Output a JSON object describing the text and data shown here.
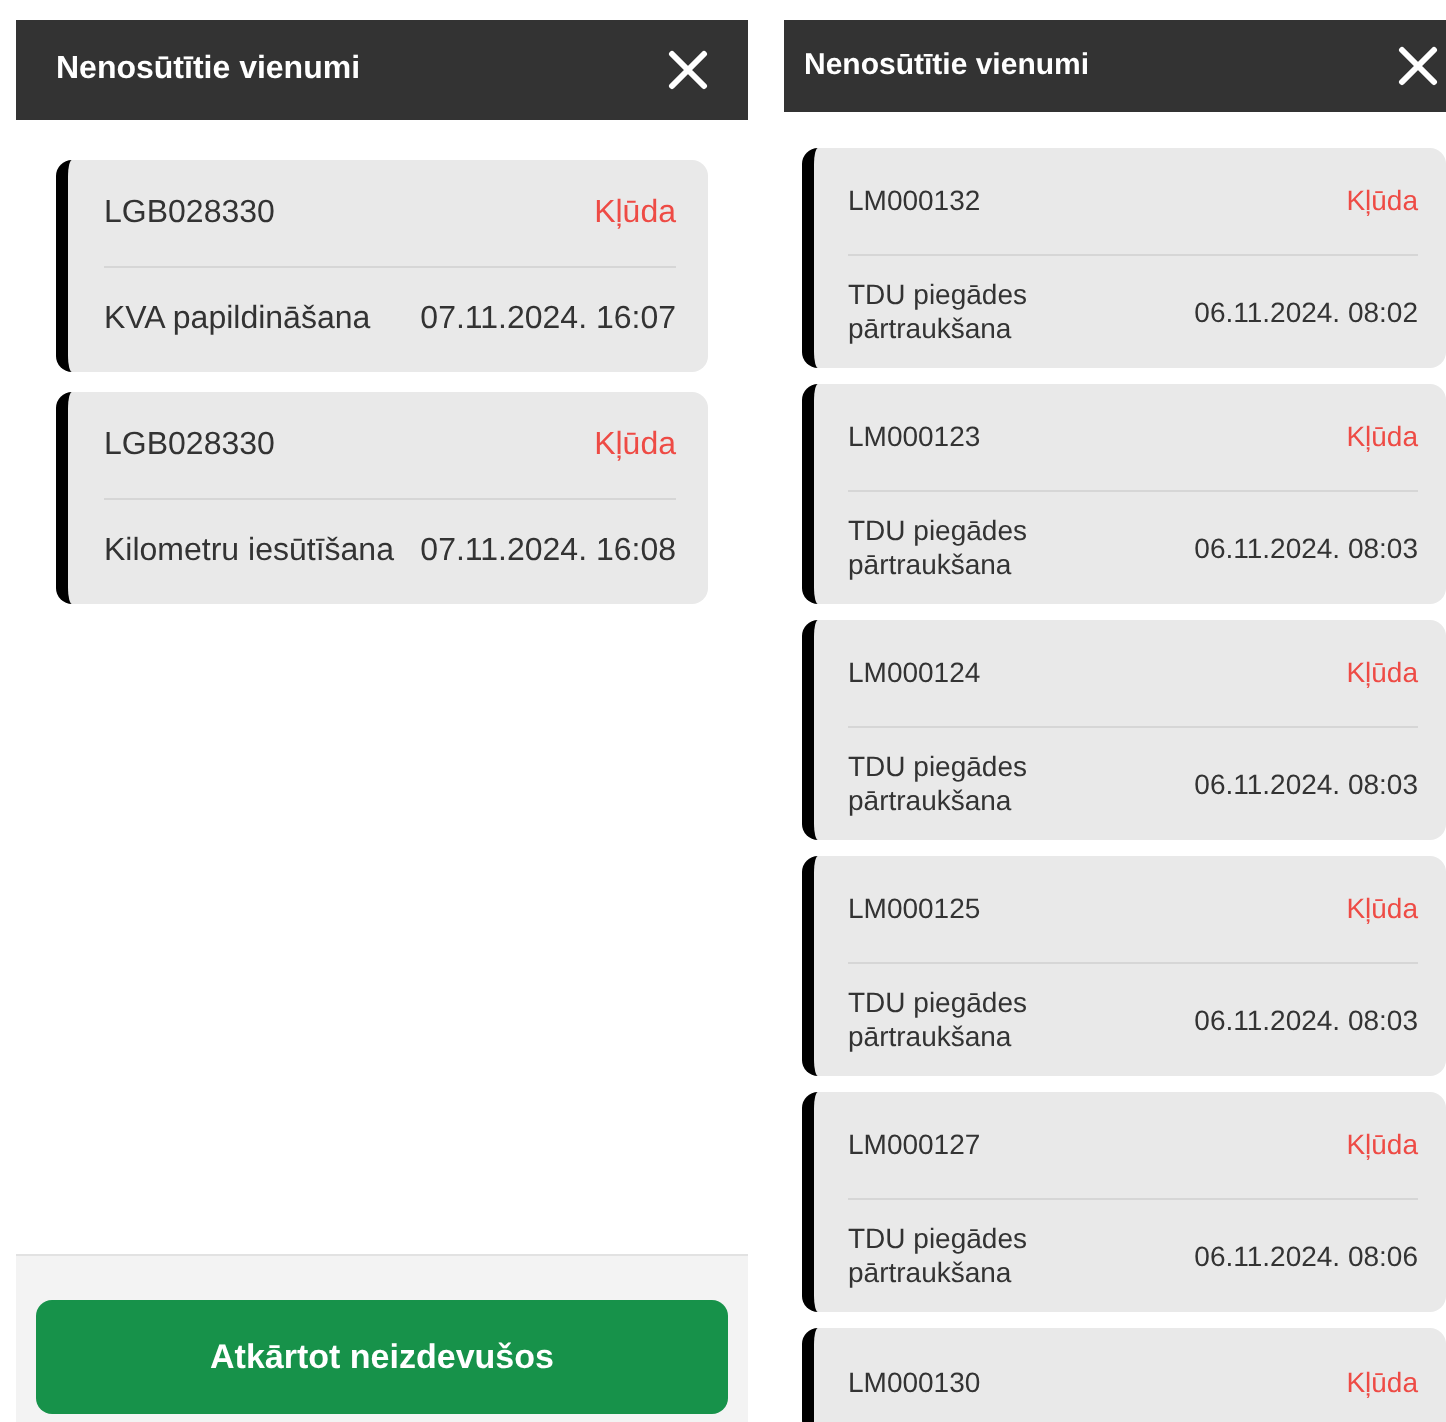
{
  "screens": [
    {
      "title": "Nenosūtītie vienumi",
      "items": [
        {
          "code": "LGB028330",
          "status": "Kļūda",
          "description": "KVA papildināšana",
          "datetime": "07.11.2024. 16:07"
        },
        {
          "code": "LGB028330",
          "status": "Kļūda",
          "description": "Kilometru iesūtīšana",
          "datetime": "07.11.2024. 16:08"
        }
      ],
      "action_button": "Atkārtot neizdevušos"
    },
    {
      "title": "Nenosūtītie vienumi",
      "items": [
        {
          "code": "LM000132",
          "status": "Kļūda",
          "description": "TDU piegādes pārtraukšana",
          "datetime": "06.11.2024. 08:02"
        },
        {
          "code": "LM000123",
          "status": "Kļūda",
          "description": "TDU piegādes pārtraukšana",
          "datetime": "06.11.2024. 08:03"
        },
        {
          "code": "LM000124",
          "status": "Kļūda",
          "description": "TDU piegādes pārtraukšana",
          "datetime": "06.11.2024. 08:03"
        },
        {
          "code": "LM000125",
          "status": "Kļūda",
          "description": "TDU piegādes pārtraukšana",
          "datetime": "06.11.2024. 08:03"
        },
        {
          "code": "LM000127",
          "status": "Kļūda",
          "description": "TDU piegādes pārtraukšana",
          "datetime": "06.11.2024. 08:06"
        },
        {
          "code": "LM000130",
          "status": "Kļūda"
        }
      ]
    }
  ]
}
